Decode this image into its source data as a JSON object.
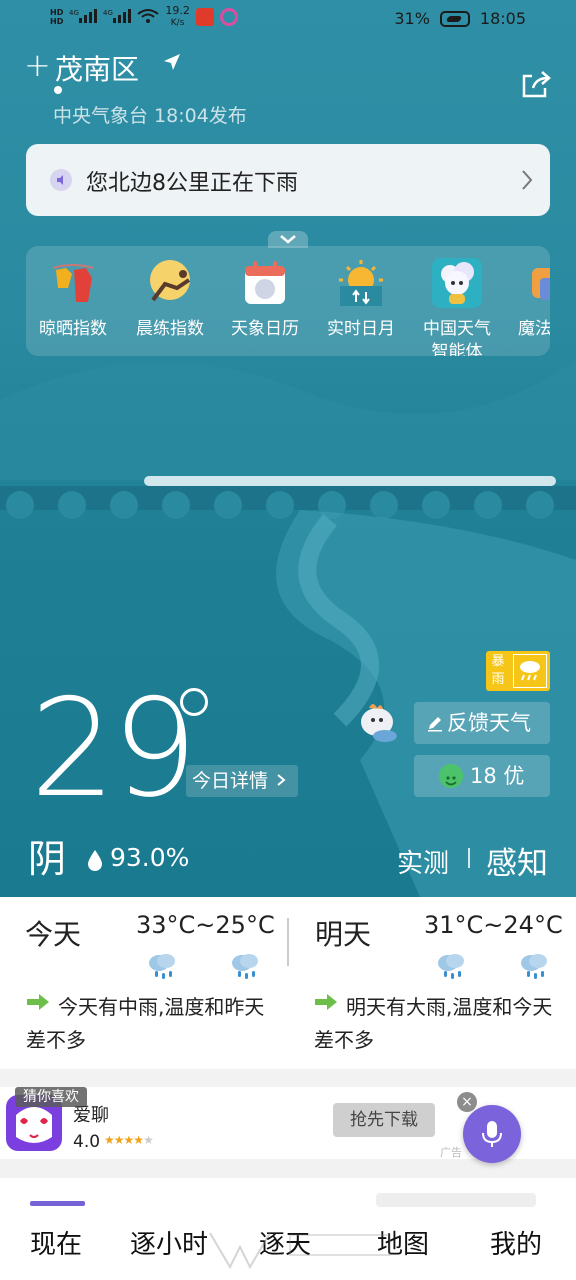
{
  "status_bar": {
    "hd1": "HD",
    "hd2": "HD",
    "net1": "4G",
    "net2": "4G",
    "speed": "19.2",
    "speed_unit": "K/s",
    "battery": "31%",
    "time": "18:05"
  },
  "header": {
    "add_icon": "plus-icon",
    "location": "茂南区",
    "publisher": "中央气象台 18:04发布",
    "share_icon": "share-icon"
  },
  "alert": {
    "text": "您北边8公里正在下雨"
  },
  "tools": [
    {
      "label": "晾晒指数",
      "icon": "laundry-icon"
    },
    {
      "label": "晨练指数",
      "icon": "exercise-icon"
    },
    {
      "label": "天象日历",
      "icon": "calendar-icon"
    },
    {
      "label": "实时日月",
      "icon": "sun-moon-icon"
    },
    {
      "label": "中国天气",
      "label2": "智能体",
      "icon": "mascot-agent-icon"
    },
    {
      "label": "魔法",
      "icon": "magic-icon"
    }
  ],
  "current": {
    "temperature": "29",
    "detail_button": "今日详情",
    "rain_badge": "暴雨",
    "feedback": "反馈天气",
    "aqi": "18 优",
    "condition": "阴",
    "humidity": "93.0%",
    "measured": "实测",
    "sense": "感知"
  },
  "forecast": {
    "today": {
      "label": "今天",
      "range": "33°C~25°C",
      "desc": "今天有中雨,温度和昨天差不多"
    },
    "tomorrow": {
      "label": "明天",
      "range": "31°C~24°C",
      "desc": "明天有大雨,温度和今天差不多"
    }
  },
  "ad": {
    "tag": "猜你喜欢",
    "name": "爱聊",
    "score": "4.0",
    "rating": 4,
    "download": "抢先下载",
    "label": "广告"
  },
  "tabs": [
    "现在",
    "逐小时",
    "逐天",
    "地图",
    "我的"
  ],
  "colors": {
    "accent": "#7563d6",
    "hero": "#2a8aa0",
    "aqi_good": "#4cc36a",
    "rain_badge": "#f5c518"
  }
}
